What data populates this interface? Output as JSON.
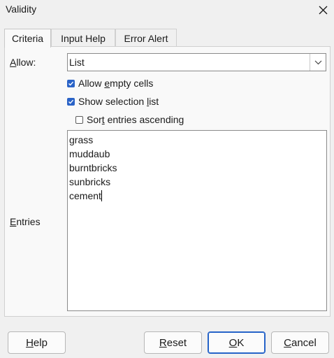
{
  "window": {
    "title": "Validity",
    "close_icon": "close-icon"
  },
  "tabs": [
    {
      "label": "Criteria",
      "active": true
    },
    {
      "label": "Input Help",
      "active": false
    },
    {
      "label": "Error Alert",
      "active": false
    }
  ],
  "criteria": {
    "allow": {
      "label_key": "A",
      "label_rest": "llow:",
      "value": "List"
    },
    "allow_empty": {
      "pre": "Allow ",
      "key": "e",
      "post": "mpty cells",
      "checked": true
    },
    "show_list": {
      "pre": "Show selection ",
      "key": "l",
      "post": "ist",
      "checked": true
    },
    "sort_entries": {
      "pre": "Sor",
      "key": "t",
      "post": " entries ascending",
      "checked": false
    },
    "entries_label": {
      "key": "E",
      "rest": "ntries"
    },
    "entries": [
      "grass",
      "muddaub",
      "burntbricks",
      "sunbricks",
      "cement"
    ]
  },
  "buttons": {
    "help": {
      "key": "H",
      "rest": "elp"
    },
    "reset": {
      "key": "R",
      "rest": "eset"
    },
    "ok": {
      "key": "O",
      "rest": "K"
    },
    "cancel": {
      "key": "C",
      "rest": "ancel"
    }
  },
  "colors": {
    "accent": "#2563c8",
    "checkbox": "#2a63c7",
    "background": "#f0f0f0"
  }
}
